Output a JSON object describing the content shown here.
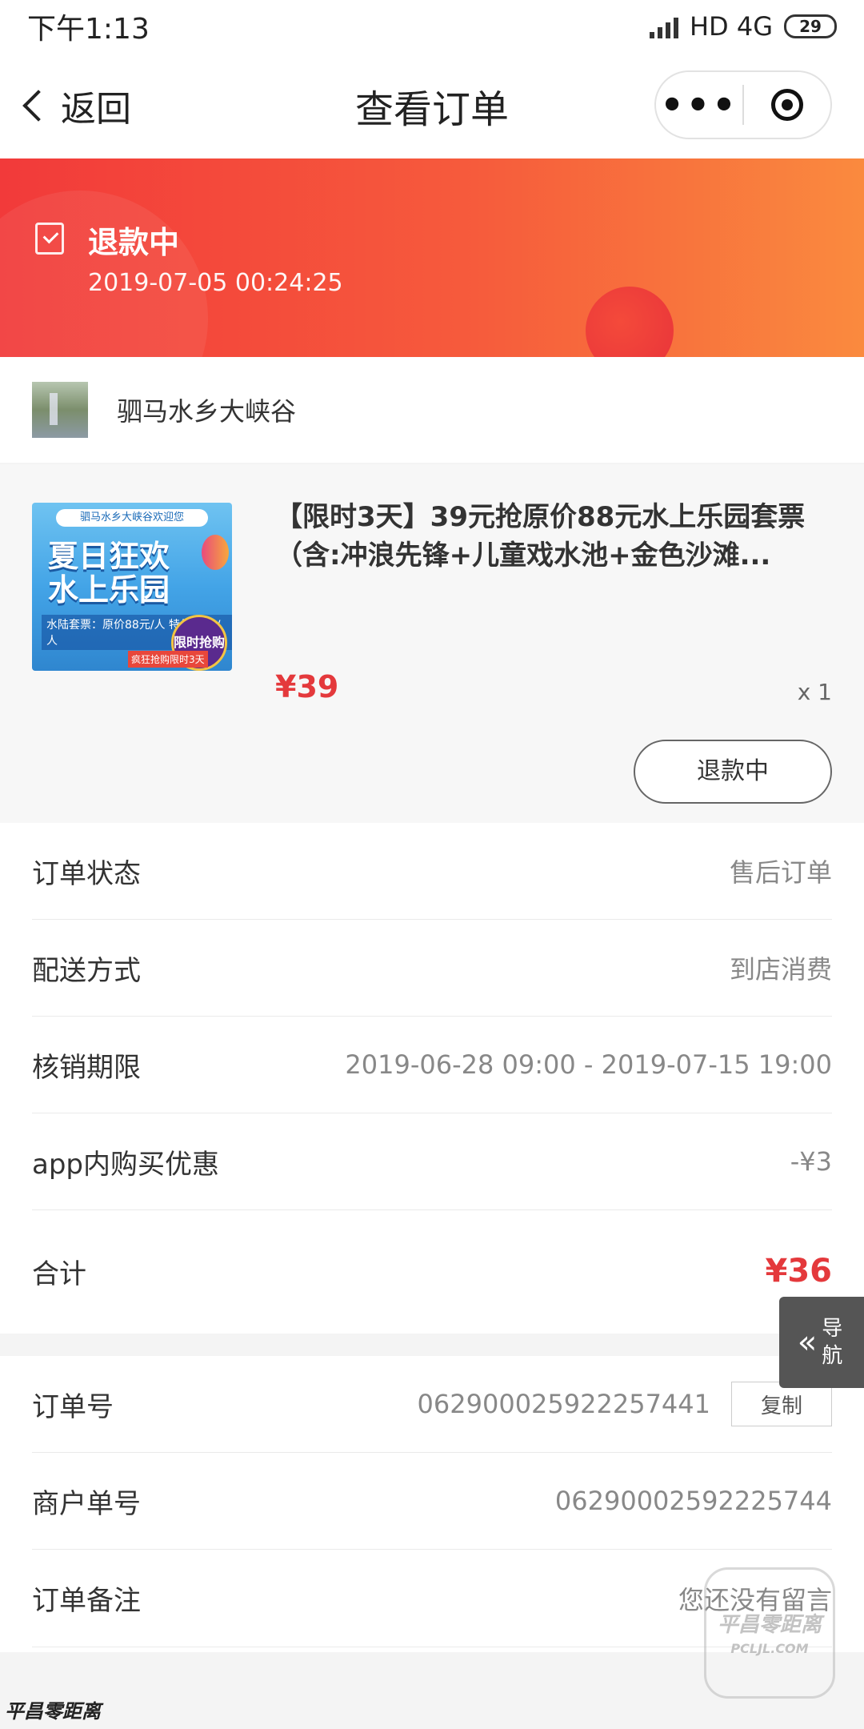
{
  "status_bar": {
    "time": "下午1:13",
    "network": "HD 4G",
    "battery": "29"
  },
  "nav": {
    "back_label": "返回",
    "title": "查看订单",
    "more_label": "•••"
  },
  "banner": {
    "status": "退款中",
    "time": "2019-07-05 00:24:25"
  },
  "shop": {
    "name": "驷马水乡大峡谷"
  },
  "product": {
    "image_text": {
      "top": "驷马水乡大峡谷欢迎您",
      "line1": "夏日狂欢",
      "line2": "水上乐园",
      "price_note": "水陆套票：原价88元/人 特价39元/人",
      "badge": "限时抢购",
      "ribbon": "疯狂抢购限时3天"
    },
    "title": "【限时3天】39元抢原价88元水上乐园套票（含:冲浪先锋+儿童戏水池+金色沙滩...",
    "price": "¥39",
    "qty": "x 1",
    "refund_button": "退款中"
  },
  "info": [
    {
      "label": "订单状态",
      "value": "售后订单"
    },
    {
      "label": "配送方式",
      "value": "到店消费"
    },
    {
      "label": "核销期限",
      "value": "2019-06-28 09:00 - 2019-07-15 19:00"
    },
    {
      "label": "app内购买优惠",
      "value": "-¥3"
    },
    {
      "label": "合计",
      "value": "¥36"
    }
  ],
  "info2": [
    {
      "label": "订单号",
      "value": "062900025922257441",
      "button": "复制"
    },
    {
      "label": "商户单号",
      "value": "06290002592225744"
    },
    {
      "label": "订单备注",
      "value": "您还没有留言"
    }
  ],
  "side_nav": {
    "label": "导航"
  },
  "watermark": {
    "box_text": "平昌零距离",
    "box_sub": "PCLJL.COM",
    "bottom": "平昌零距离"
  },
  "colors": {
    "accent_red": "#e4393c",
    "banner_start": "#f23a3a",
    "banner_end": "#fa8a3e"
  }
}
